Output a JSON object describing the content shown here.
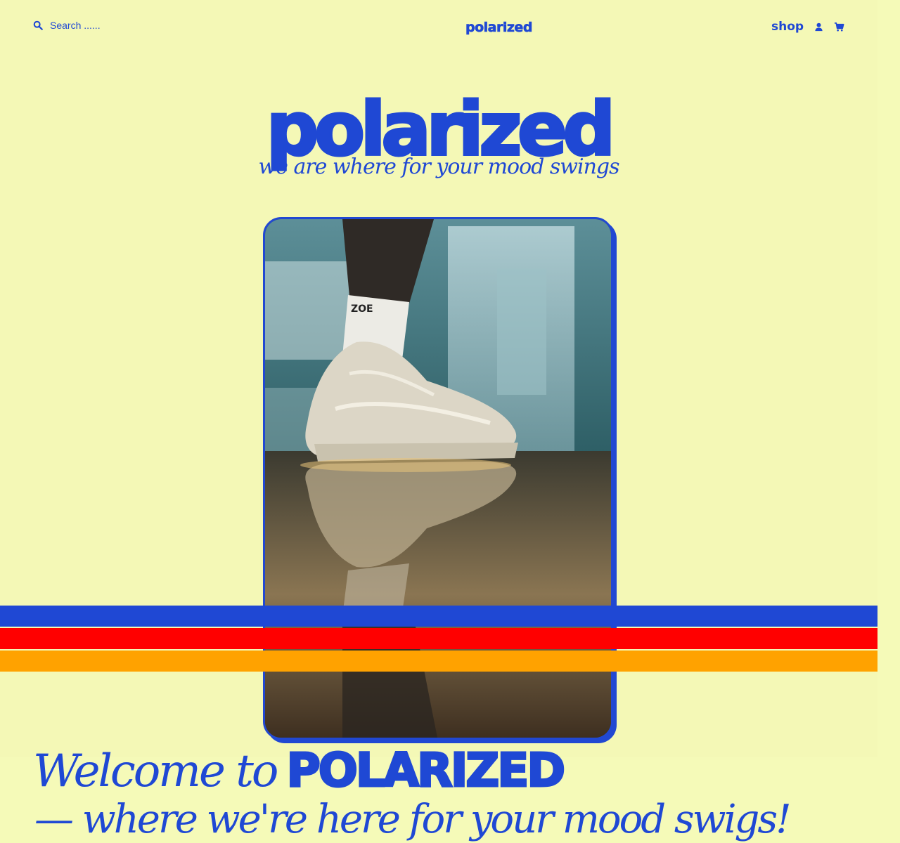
{
  "header": {
    "search_placeholder": "Search ......",
    "logo": "polarized",
    "shop_label": "shop",
    "icons": [
      "search-icon",
      "user-icon",
      "cart-icon"
    ]
  },
  "hero": {
    "title": "polarized",
    "tagline": "we are where for your mood swings",
    "image_alt": "White sneaker with ZOE sock stepping into a puddle",
    "sock_text": "ZOE"
  },
  "welcome": {
    "prefix": "Welcome to",
    "brand": "POLARIZED",
    "subline": "— where we're here for your mood swigs!"
  },
  "colors": {
    "background": "#f5fab8",
    "brand_blue": "#1f48d4",
    "stripe_red": "#ff0000",
    "stripe_orange": "#ffa200"
  }
}
